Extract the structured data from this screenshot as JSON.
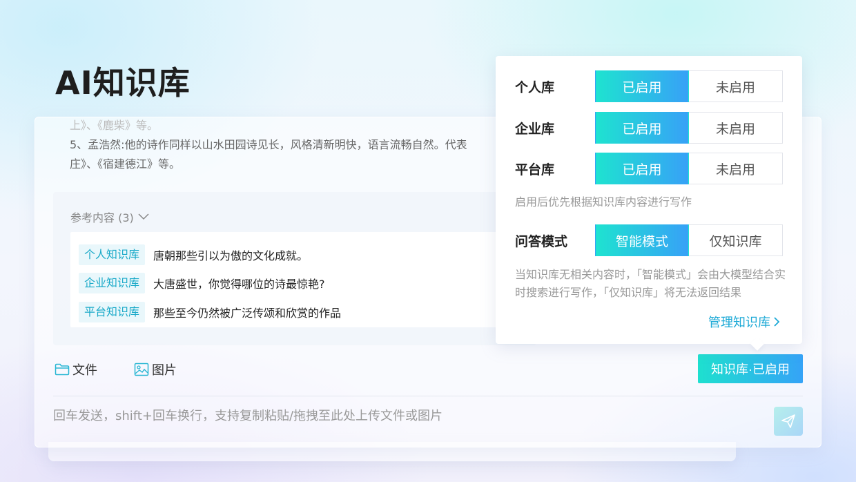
{
  "page": {
    "title": "AI知识库"
  },
  "answer": {
    "faded_line": "上》、《鹿柴》等。",
    "line1": "5、孟浩然:他的诗作同样以山水田园诗见长，风格清新明快，语言流畅自然。代表",
    "line2": "庄》、《宿建德江》等。"
  },
  "references": {
    "header": "参考内容 (3)",
    "items": [
      {
        "tag": "个人知识库",
        "text": "唐朝那些引以为傲的文化成就。"
      },
      {
        "tag": "企业知识库",
        "text": "大唐盛世，你觉得哪位的诗最惊艳?"
      },
      {
        "tag": "平台知识库",
        "text": "那些至今仍然被广泛传颂和欣赏的作品"
      }
    ]
  },
  "toolbar": {
    "file_label": "文件",
    "image_label": "图片",
    "kb_status_label": "知识库·已启用"
  },
  "input": {
    "placeholder": "回车发送，shift+回车换行，支持复制粘贴/拖拽至此处上传文件或图片"
  },
  "popover": {
    "rows": [
      {
        "label": "个人库",
        "on": "已启用",
        "off": "未启用",
        "selected": "on"
      },
      {
        "label": "企业库",
        "on": "已启用",
        "off": "未启用",
        "selected": "on"
      },
      {
        "label": "平台库",
        "on": "已启用",
        "off": "未启用",
        "selected": "on"
      }
    ],
    "hint1": "启用后优先根据知识库内容进行写作",
    "qa": {
      "label": "问答模式",
      "option1": "智能模式",
      "option2": "仅知识库",
      "selected": "option1"
    },
    "hint2": "当知识库无相关内容时，「智能模式」会由大模型结合实时搜索进行写作，「仅知识库」将无法返回结果",
    "manage_link": "管理知识库"
  },
  "colors": {
    "accent_start": "#1ee3d0",
    "accent_end": "#37a1f7",
    "link": "#1ca9d6",
    "tag_text": "#19a9c8"
  },
  "icons": {
    "file": "folder-icon",
    "image": "image-icon",
    "chevron": "chevron-down-icon",
    "arrow": "chevron-right-icon",
    "send": "paper-plane-icon"
  }
}
